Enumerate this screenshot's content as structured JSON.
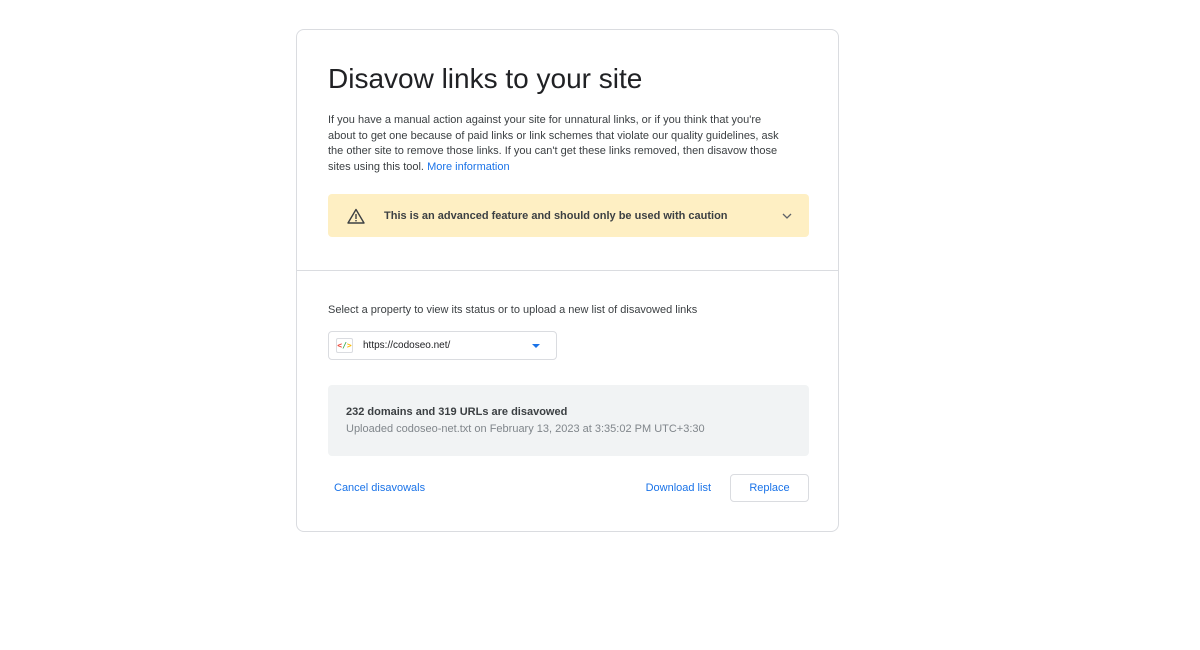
{
  "header": {
    "title": "Disavow links to your site"
  },
  "description": {
    "text": "If you have a manual action against your site for unnatural links, or if you think that you're about to get one because of paid links or link schemes that violate our quality guidelines, ask the other site to remove those links. If you can't get these links removed, then disavow those sites using this tool.",
    "link_label": "More information"
  },
  "warning": {
    "icon": "warning-triangle-icon",
    "text": "This is an advanced feature and should only be used with caution",
    "expand_icon": "chevron-down-icon"
  },
  "property": {
    "label": "Select a property to view its status or to upload a new list of disavowed links",
    "selected_value": "https://codoseo.net/",
    "favicon": "code-brackets-icon"
  },
  "status": {
    "summary": "232 domains and 319 URLs are disavowed",
    "uploaded": "Uploaded codoseo-net.txt on February 13, 2023 at 3:35:02 PM UTC+3:30"
  },
  "actions": {
    "cancel_label": "Cancel disavowals",
    "download_label": "Download list",
    "replace_label": "Replace"
  },
  "colors": {
    "accent": "#1a73e8",
    "warning_bg": "#feefc3",
    "status_bg": "#f1f3f4",
    "border": "#dadce0"
  }
}
